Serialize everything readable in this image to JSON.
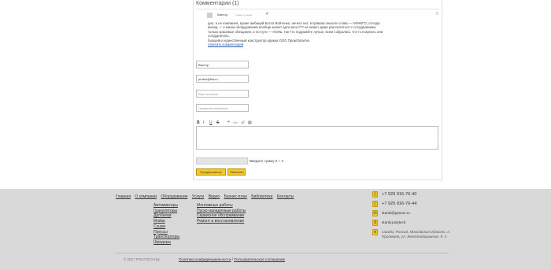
{
  "comments": {
    "title": "Комментарии (1)",
    "item": {
      "author": "Виктор",
      "date": "1 минуту назад",
      "number": "0",
      "text_lines": [
        "дно, а не компания, кроме амбиций Босса Войтенко, ничего нет, в прямом смысле слова — НИЧЕГО, отсюда",
        "вывод — о каком оборудовании вообще может идти речь??? не может даже рассчитаться с сотрудниками,",
        "только красивые обещания, а по-сути — НОЛЬ, так что подумайте лучше, всем собрались что-то покупать или",
        "сотрудничать.",
        "бывший и единственный конструктор кружка ООО ПромПолитех"
      ],
      "reply": "ответить комментарий"
    },
    "form": {
      "name_value": "Виктор",
      "email_value": "probin@list.ru",
      "phone_placeholder": "Ваш телефон",
      "company_placeholder": "Название компании",
      "toolbar": [
        "B",
        "I",
        "U",
        "S",
        "❝",
        "</>",
        "🔗",
        "▤"
      ],
      "message_value": "",
      "captcha_label": "Введите сумму 5 + 3",
      "preview_label": "Предпросмотр",
      "submit_label": "Написать"
    }
  },
  "footer": {
    "nav": [
      "Главная",
      "О компании",
      "Оборудование",
      "Услуги",
      "Видео",
      "Бизнес-план",
      "Библиотека",
      "Контакты"
    ],
    "equipment": [
      "Автомиксеры",
      "Грануляторы",
      "Дробилки",
      "Мойки",
      "Сушки",
      "Прессы",
      "Транспортеры",
      "Шредеры"
    ],
    "services": [
      "Монтажные работы",
      "Пуско-наладочные работы",
      "Сервисное обслуживание",
      "Ремонт и восстановление"
    ],
    "contacts": {
      "phone1": "+7 929 916-76-40",
      "phone2": "+7 929 916-76-44",
      "email": "stanki@ppsrus.ru",
      "skype": "stanki.polytech",
      "address": "142281, Россия, Московская область, г. Протвино, ул. Железнодорожная, 9. 3"
    },
    "copyright": "© 2017 POLYTECH.by",
    "legal_privacy": "Политика конфиденциальности",
    "legal_separator": "/",
    "legal_terms": "Пользовательское соглашение"
  },
  "colors": {
    "accent": "#f6c927",
    "footer_bg": "#d9d9d9",
    "link": "#2b5ea8"
  }
}
